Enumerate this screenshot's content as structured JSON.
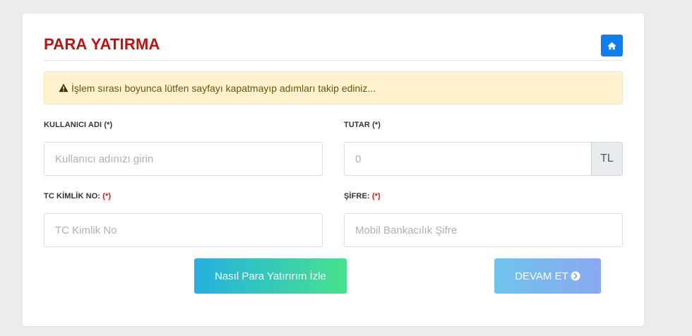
{
  "page": {
    "title": "PARA YATIRMA",
    "home_icon": "home-icon"
  },
  "alert": {
    "icon": "warning-icon",
    "text": "İşlem sırası boyunca lütfen sayfayı kapatmayıp adımları takip ediniz..."
  },
  "form": {
    "username": {
      "label": "KULLANICI ADI",
      "required_mark": "(*)",
      "placeholder": "Kullanıcı adınızı girin",
      "value": ""
    },
    "amount": {
      "label": "TUTAR",
      "required_mark": "(*)",
      "placeholder": "0",
      "value": "",
      "unit": "TL"
    },
    "tc_id": {
      "label": "TC KİMLİK NO:",
      "required_mark": "(*)",
      "placeholder": "TC Kimlik No",
      "value": ""
    },
    "password": {
      "label": "ŞİFRE:",
      "required_mark": "(*)",
      "placeholder": "Mobil Bankacılık Şifre",
      "value": ""
    }
  },
  "buttons": {
    "watch_label": "Nasıl Para Yatırırım İzle",
    "continue_label": "DEVAM ET",
    "continue_icon": "arrow-circle-right-icon"
  },
  "colors": {
    "title": "#c0100f",
    "home_button": "#0d7ff2",
    "alert_bg": "#fff2cc",
    "required": "#d51414"
  }
}
